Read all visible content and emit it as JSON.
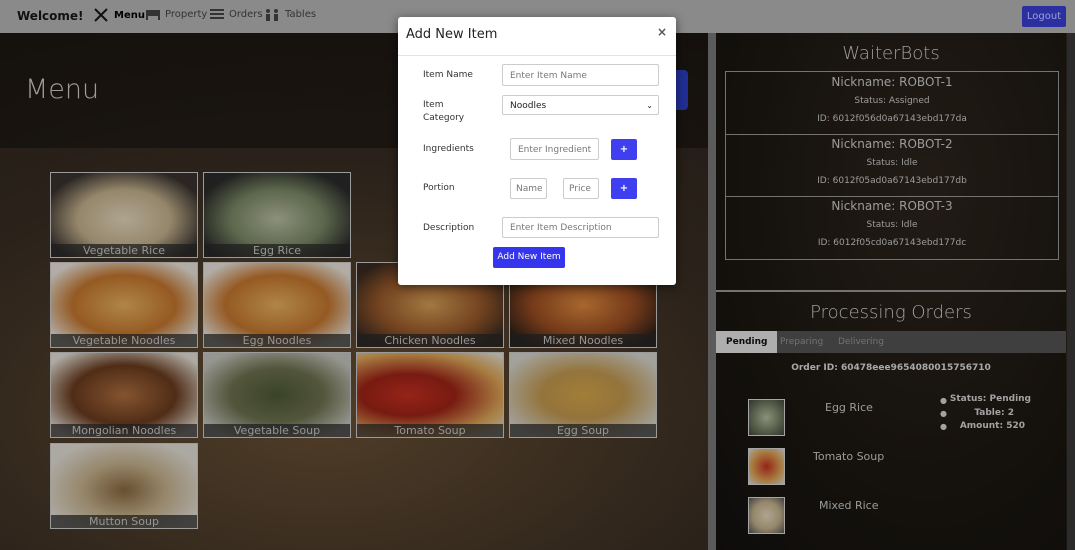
{
  "nav": {
    "brand": "Welcome!",
    "items": [
      {
        "label": "Menu",
        "icon": "utensils-icon"
      },
      {
        "label": "Property",
        "icon": "bed-icon"
      },
      {
        "label": "Orders",
        "icon": "list-icon"
      },
      {
        "label": "Tables",
        "icon": "people-icon"
      }
    ],
    "logout": "Logout"
  },
  "page": {
    "title": "Menu"
  },
  "menu_items": [
    "Vegetable Rice",
    "Egg Rice",
    "Chicken Noodles",
    "Mixed Noodles",
    "Vegetable Noodles",
    "Egg Noodles",
    "Mongolian Noodles",
    "Vegetable Soup",
    "Tomato Soup",
    "Egg Soup",
    "Mutton Soup"
  ],
  "waiterbots": {
    "title": "WaiterBots",
    "bots": [
      {
        "nickname": "Nickname: ROBOT-1",
        "status": "Status: Assigned",
        "id": "ID: 6012f056d0a67143ebd177da"
      },
      {
        "nickname": "Nickname: ROBOT-2",
        "status": "Status: Idle",
        "id": "ID: 6012f05ad0a67143ebd177db"
      },
      {
        "nickname": "Nickname: ROBOT-3",
        "status": "Status: Idle",
        "id": "ID: 6012f05cd0a67143ebd177dc"
      }
    ]
  },
  "orders": {
    "title": "Processing Orders",
    "tabs": [
      "Pending",
      "Preparing",
      "Delivering"
    ],
    "order_id": "Order ID: 60478eee9654080015756710",
    "items": [
      "Egg Rice",
      "Tomato Soup",
      "Mixed Rice"
    ],
    "status": "Status: Pending",
    "table": "Table: 2",
    "amount": "Amount: 520"
  },
  "modal": {
    "title": "Add New Item",
    "close": "×",
    "labels": {
      "name": "Item Name",
      "category": "Item Category",
      "ingredients": "Ingredients",
      "portion": "Portion",
      "description": "Description"
    },
    "placeholders": {
      "name": "Enter Item Name",
      "ingredient": "Enter Ingredient",
      "portion_name": "Name",
      "portion_price": "Price",
      "description": "Enter Item Description"
    },
    "category_value": "Noodles",
    "plus": "+",
    "submit": "Add New Item"
  },
  "colors": {
    "accent": "#3535ee",
    "logout": "#2b2fa0",
    "nav": "#8a8a8a"
  }
}
